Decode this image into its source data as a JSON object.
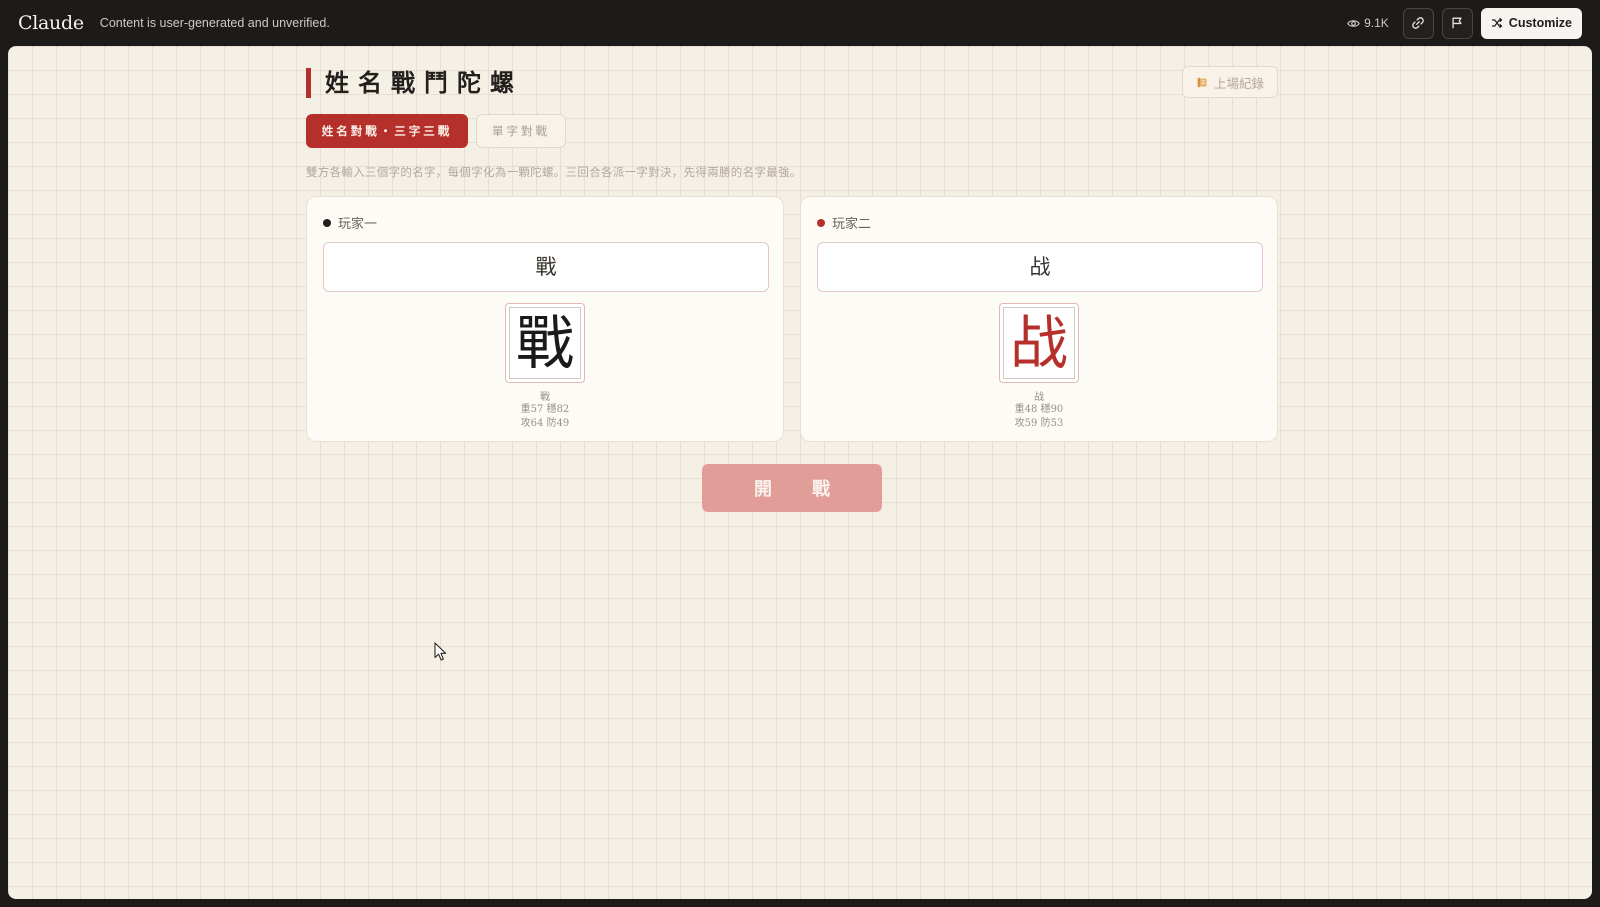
{
  "topbar": {
    "brand": "Claude",
    "notice": "Content is user-generated and unverified.",
    "views": "9.1K",
    "customize_label": "Customize"
  },
  "app": {
    "title": "姓名戰鬥陀螺",
    "history_label": "上場紀錄",
    "tabs": [
      {
        "label": "姓名對戰・三字三戰",
        "active": true
      },
      {
        "label": "單字對戰",
        "active": false
      }
    ],
    "description": "雙方各輸入三個字的名字，每個字化為一顆陀螺。三回合各派一字對決，先得兩勝的名字最強。",
    "players": [
      {
        "label": "玩家一",
        "input_value": "戰",
        "card": {
          "glyph": "戰",
          "char": "戰",
          "stat1": "重57 穩82",
          "stat2": "攻64 防49"
        }
      },
      {
        "label": "玩家二",
        "input_value": "战",
        "card": {
          "glyph": "战",
          "char": "战",
          "stat1": "重48 穩90",
          "stat2": "攻59 防53"
        }
      }
    ],
    "fight_label": "開戰"
  },
  "colors": {
    "accent": "#b5302a",
    "fight_button_disabled": "#e09a95",
    "canvas_bg": "#f5f0e6",
    "topbar_bg": "#1c1b1a"
  },
  "icons": [
    "eye-icon",
    "link-icon",
    "flag-icon",
    "shuffle-icon",
    "scroll-icon",
    "cursor-icon"
  ]
}
